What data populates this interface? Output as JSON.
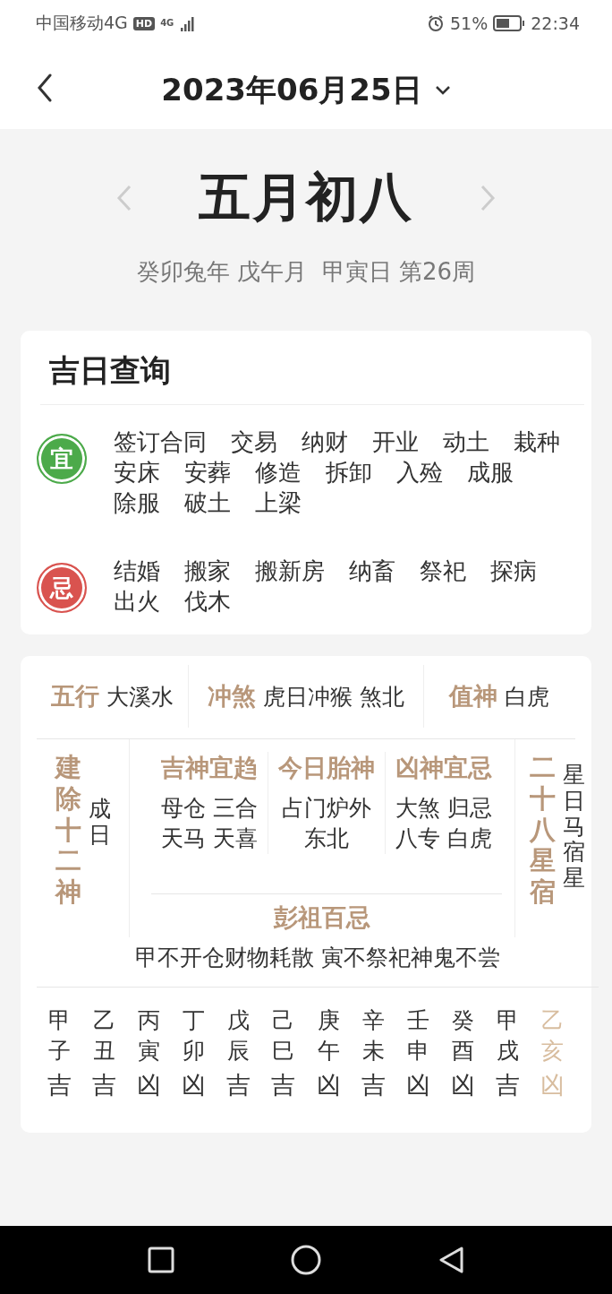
{
  "status_bar": {
    "carrier": "中国移动4G",
    "network_badge": "HD",
    "network_type": "4G",
    "battery_percent": "51%",
    "time": "22:34"
  },
  "header": {
    "title": "2023年06月25日"
  },
  "lunar": {
    "date": "五月初八",
    "ganzhi": "癸卯兔年 戊午月  甲寅日 第26周"
  },
  "lucky_card": {
    "title": "吉日查询",
    "rows": [
      {
        "kind": "good",
        "badge": "宜",
        "items": [
          "签订合同",
          "交易",
          "纳财",
          "开业",
          "动土",
          "栽种",
          "安床",
          "安葬",
          "修造",
          "拆卸",
          "入殓",
          "成服",
          "除服",
          "破土",
          "上梁"
        ]
      },
      {
        "kind": "bad",
        "badge": "忌",
        "items": [
          "结婚",
          "搬家",
          "搬新房",
          "纳畜",
          "祭祀",
          "探病",
          "出火",
          "伐木"
        ]
      }
    ]
  },
  "detail_card": {
    "top": [
      {
        "label": "五行",
        "value": "大溪水"
      },
      {
        "label": "冲煞",
        "value": "虎日冲猴 煞北"
      },
      {
        "label": "值神",
        "value": "白虎"
      }
    ],
    "left": {
      "label": "建除十二神",
      "value": "成日"
    },
    "middle": [
      {
        "label": "吉神宜趋",
        "items": [
          "母仓",
          "三合",
          "天马",
          "天喜"
        ]
      },
      {
        "label": "今日胎神",
        "items": [
          "占门炉外",
          "东北"
        ]
      },
      {
        "label": "凶神宜忌",
        "items": [
          "大煞",
          "归忌",
          "八专",
          "白虎"
        ]
      }
    ],
    "right": {
      "label": "二十八星宿",
      "value": "星日马宿星"
    },
    "pengzu": {
      "label": "彭祖百忌",
      "value": "甲不开仓财物耗散 寅不祭祀神鬼不尝"
    },
    "hours": [
      {
        "stem": "甲",
        "branch": "子",
        "verdict": "吉",
        "selected": false
      },
      {
        "stem": "乙",
        "branch": "丑",
        "verdict": "吉",
        "selected": false
      },
      {
        "stem": "丙",
        "branch": "寅",
        "verdict": "凶",
        "selected": false
      },
      {
        "stem": "丁",
        "branch": "卯",
        "verdict": "凶",
        "selected": false
      },
      {
        "stem": "戊",
        "branch": "辰",
        "verdict": "吉",
        "selected": false
      },
      {
        "stem": "己",
        "branch": "巳",
        "verdict": "吉",
        "selected": false
      },
      {
        "stem": "庚",
        "branch": "午",
        "verdict": "凶",
        "selected": false
      },
      {
        "stem": "辛",
        "branch": "未",
        "verdict": "吉",
        "selected": false
      },
      {
        "stem": "壬",
        "branch": "申",
        "verdict": "凶",
        "selected": false
      },
      {
        "stem": "癸",
        "branch": "酉",
        "verdict": "凶",
        "selected": false
      },
      {
        "stem": "甲",
        "branch": "戌",
        "verdict": "吉",
        "selected": false
      },
      {
        "stem": "乙",
        "branch": "亥",
        "verdict": "凶",
        "selected": true
      }
    ]
  }
}
